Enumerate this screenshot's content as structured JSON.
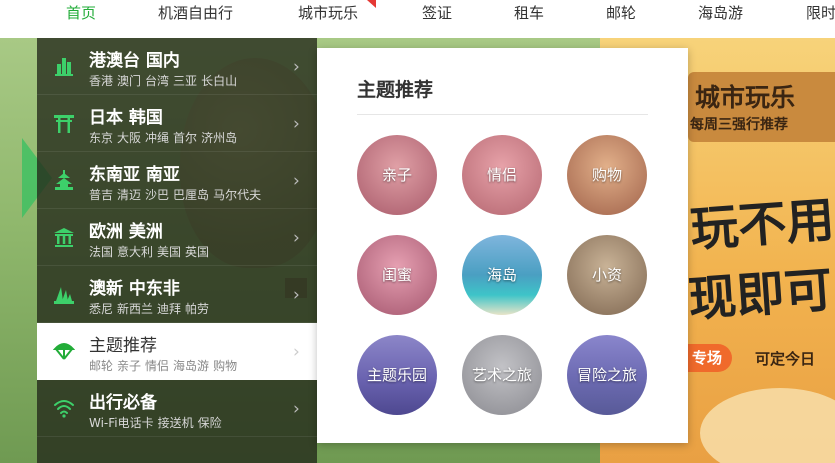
{
  "nav": {
    "items": [
      "首页",
      "机酒自由行",
      "城市玩乐",
      "签证",
      "租车",
      "邮轮",
      "海岛游",
      "限时"
    ],
    "active_index": 0,
    "accent_color": "#22ac38"
  },
  "sidebar": {
    "categories": [
      {
        "title": "港澳台 国内",
        "icon": "buildings-icon",
        "subs": [
          "香港",
          "澳门",
          "台湾",
          "三亚",
          "长白山"
        ]
      },
      {
        "title": "日本 韩国",
        "icon": "torii-gate-icon",
        "subs": [
          "东京",
          "大阪",
          "冲绳",
          "首尔",
          "济州岛"
        ]
      },
      {
        "title": "东南亚 南亚",
        "icon": "pagoda-icon",
        "subs": [
          "普吉",
          "清迈",
          "沙巴",
          "巴厘岛",
          "马尔代夫"
        ]
      },
      {
        "title": "欧洲 美洲",
        "icon": "temple-icon",
        "subs": [
          "法国",
          "意大利",
          "美国",
          "英国"
        ]
      },
      {
        "title": "澳新 中东非",
        "icon": "opera-house-icon",
        "subs": [
          "悉尼",
          "新西兰",
          "迪拜",
          "帕劳"
        ]
      },
      {
        "title": "主题推荐",
        "icon": "parachute-icon",
        "subs": [
          "邮轮",
          "亲子",
          "情侣",
          "海岛游",
          "购物"
        ]
      },
      {
        "title": "出行必备",
        "icon": "wifi-icon",
        "subs": [
          "Wi-Fi电话卡",
          "接送机",
          "保险"
        ]
      }
    ],
    "active_index": 5
  },
  "panel": {
    "title": "主题推荐",
    "themes": [
      "亲子",
      "情侣",
      "购物",
      "闺蜜",
      "海岛",
      "小资",
      "主题乐园",
      "艺术之旅",
      "冒险之旅"
    ]
  },
  "promo": {
    "title": "城市玩乐",
    "subtitle": "每周三强行推荐",
    "big_line1": "玩不用",
    "big_line2": "现即可",
    "badge": "专场",
    "tail": "可定今日"
  }
}
